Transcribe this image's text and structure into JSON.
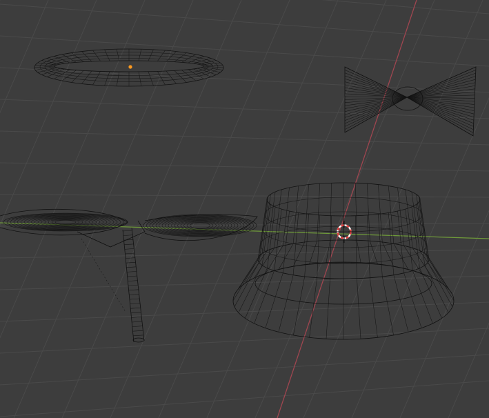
{
  "viewport": {
    "name": "3D Viewport",
    "background": "#3d3d3d",
    "grid_color": "#4a4a4a",
    "x_axis_color": "#a04650",
    "y_axis_color": "#6f9a3a",
    "wire_color": "#111111",
    "origin_color": "#ff9a1f",
    "cursor_colors": [
      "#e23c3c",
      "#ffffff"
    ]
  },
  "objects": [
    {
      "name": "torus-ring",
      "type": "mesh",
      "display": "wireframe",
      "selected_origin": true
    },
    {
      "name": "bow-tie",
      "type": "mesh",
      "display": "wireframe"
    },
    {
      "name": "leaf-sprout",
      "type": "mesh",
      "display": "wireframe"
    },
    {
      "name": "bucket-hat",
      "type": "mesh",
      "display": "wireframe"
    }
  ],
  "cursor": {
    "icon": "3d-cursor-icon"
  }
}
